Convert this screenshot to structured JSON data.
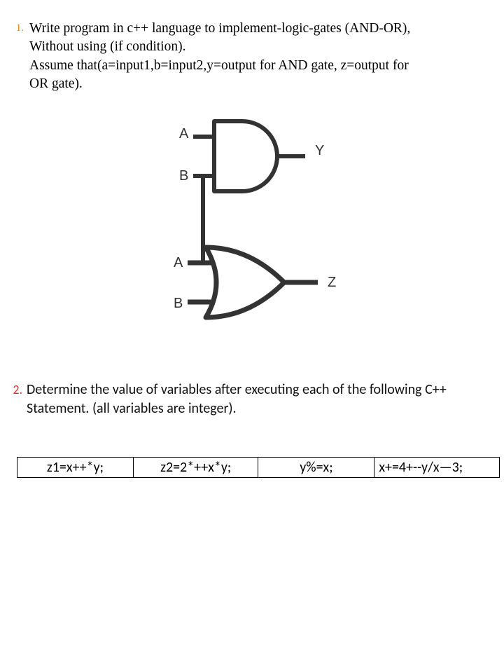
{
  "q1": {
    "num": "1.",
    "line1": "Write program in c++ language to implement-logic-gates (AND-OR),",
    "line2": "Without using (if condition).",
    "line3": "Assume that(a=input1,b=input2,y=output for AND gate, z=output  for",
    "line4": "OR gate)."
  },
  "diagram": {
    "and": {
      "in1": "A",
      "in2": "B",
      "out": "Y"
    },
    "or": {
      "in1": "A",
      "in2": "B",
      "out": "Z"
    }
  },
  "q2": {
    "num": "2.",
    "line1": "Determine the value of variables after executing  each of the following C++",
    "line2": "Statement. (all variables are integer)."
  },
  "table": {
    "c1": "z1=x++*y;",
    "c2": "z2=2*++x*y;",
    "c3": "y%=x;",
    "c4": "x+=4+--y/x—3;"
  }
}
